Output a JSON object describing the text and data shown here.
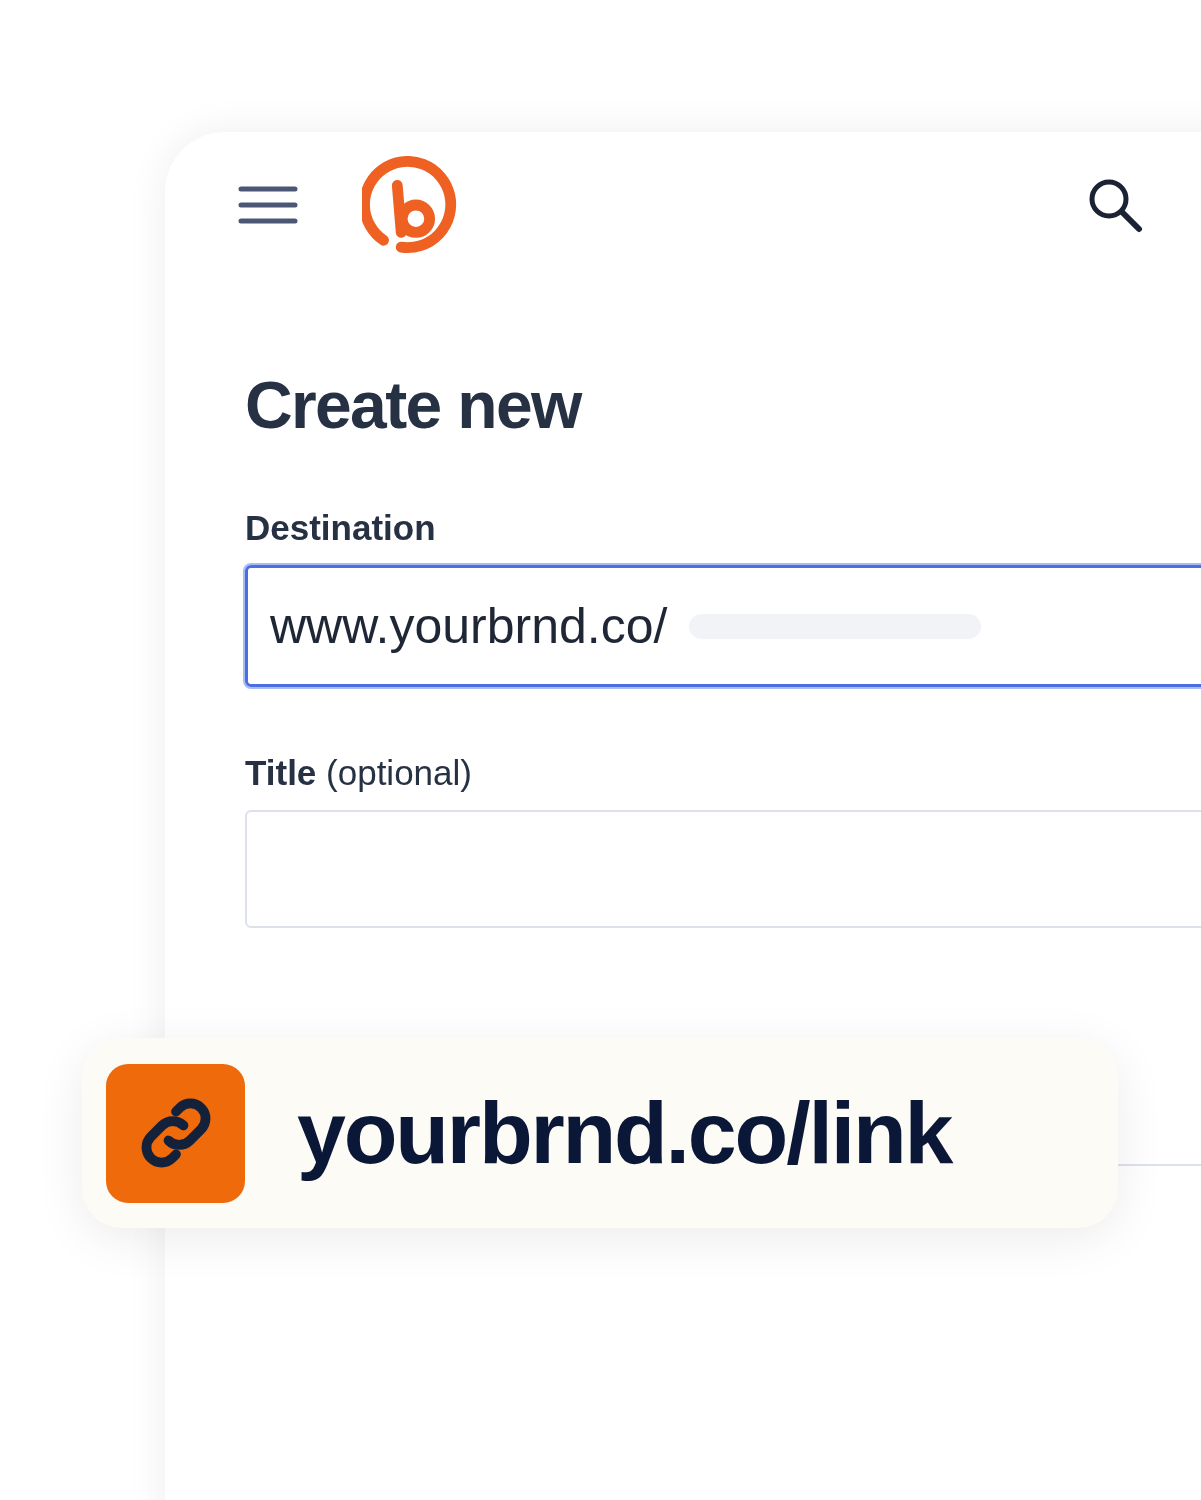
{
  "heading": "Create new",
  "fields": [
    {
      "label": "Destination",
      "value": "www.yourbrnd.co/",
      "focused": true,
      "masked_tail": true
    },
    {
      "label": "Title",
      "hint": "(optional)",
      "focused": false,
      "masked_tail": false
    }
  ],
  "short_link": {
    "text": "yourbrnd.co/link"
  }
}
